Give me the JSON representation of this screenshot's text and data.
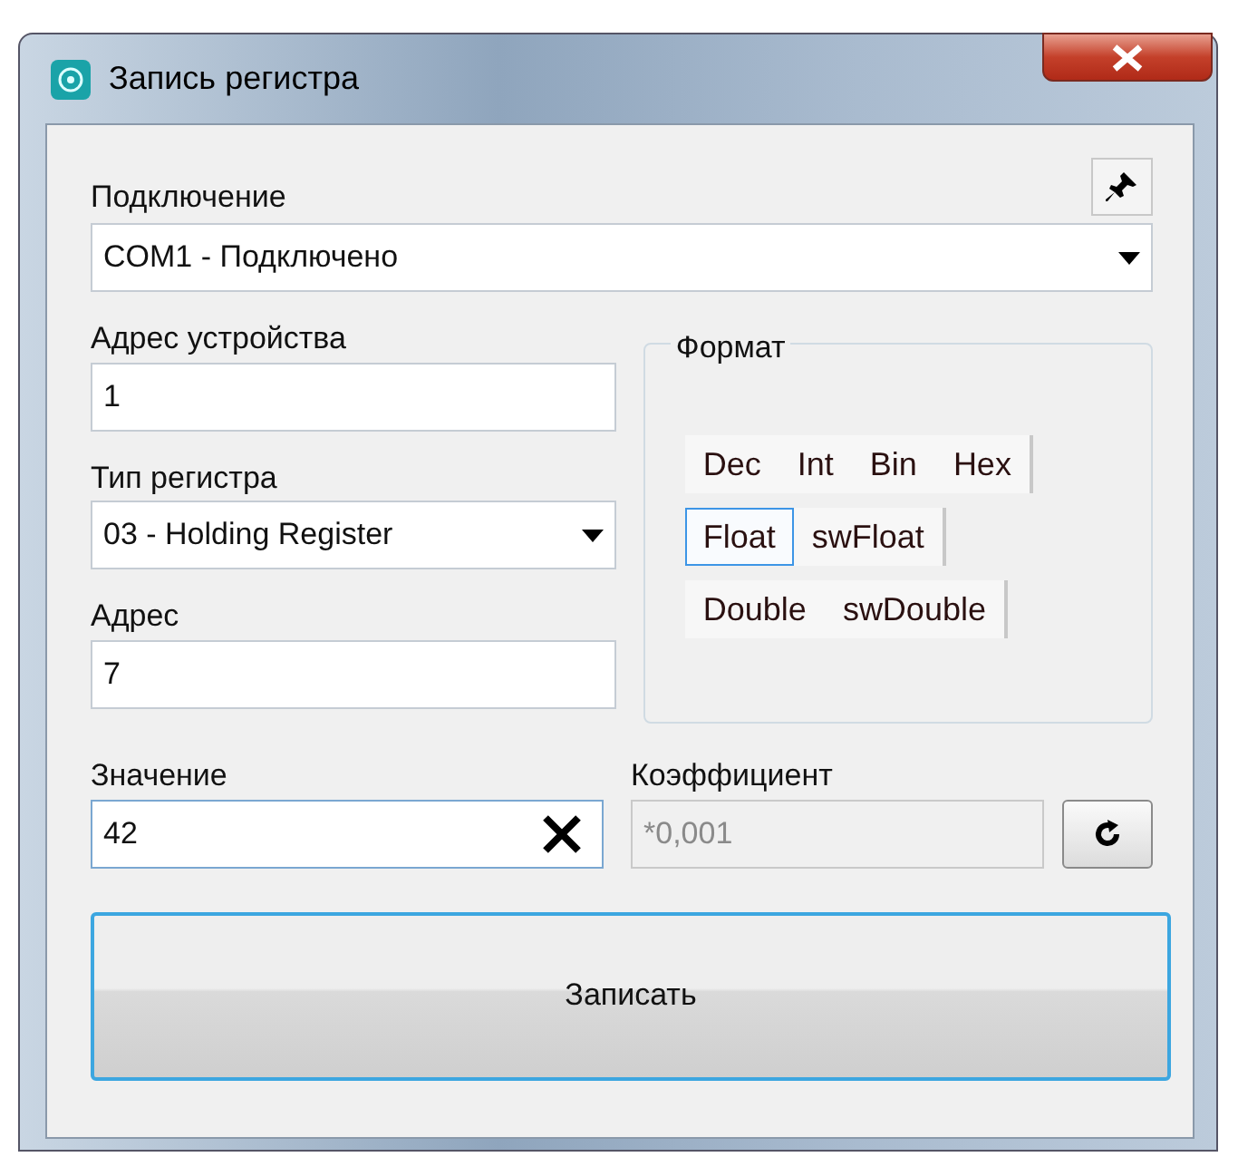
{
  "window": {
    "title": "Запись регистра"
  },
  "connection": {
    "label": "Подключение",
    "value": "COM1 - Подключено"
  },
  "device_address": {
    "label": "Адрес устройства",
    "value": "1"
  },
  "register_type": {
    "label": "Тип регистра",
    "value": "03 - Holding Register"
  },
  "address": {
    "label": "Адрес",
    "value": "7"
  },
  "value": {
    "label": "Значение",
    "value": "42"
  },
  "format": {
    "title": "Формат",
    "rows": [
      [
        {
          "label": "Dec",
          "selected": false
        },
        {
          "label": "Int",
          "selected": false
        },
        {
          "label": "Bin",
          "selected": false
        },
        {
          "label": "Hex",
          "selected": false
        }
      ],
      [
        {
          "label": "Float",
          "selected": true
        },
        {
          "label": "swFloat",
          "selected": false
        }
      ],
      [
        {
          "label": "Double",
          "selected": false
        },
        {
          "label": "swDouble",
          "selected": false
        }
      ]
    ]
  },
  "coefficient": {
    "label": "Коэффициент",
    "placeholder": "*0,001",
    "disabled": true
  },
  "write_button": "Записать"
}
